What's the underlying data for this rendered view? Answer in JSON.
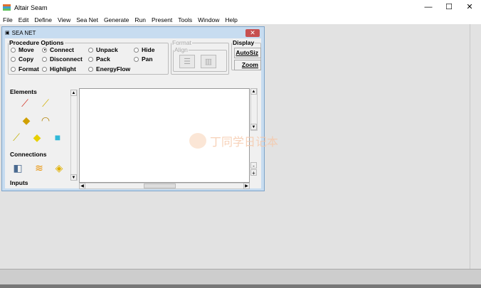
{
  "app": {
    "title": "Altair Seam",
    "minimize": "—",
    "maximize": "☐",
    "close": "✕"
  },
  "menu": [
    "File",
    "Edit",
    "Define",
    "View",
    "Sea Net",
    "Generate",
    "Run",
    "Present",
    "Tools",
    "Window",
    "Help"
  ],
  "child": {
    "title": "SEA NET",
    "close": "✕",
    "procedure_options": {
      "legend": "Procedure Options",
      "options": [
        {
          "label": "Move",
          "selected": false
        },
        {
          "label": "Connect",
          "selected": true
        },
        {
          "label": "Unpack",
          "selected": false
        },
        {
          "label": "Hide",
          "selected": false
        },
        {
          "label": "Copy",
          "selected": false
        },
        {
          "label": "Disconnect",
          "selected": false
        },
        {
          "label": "Pack",
          "selected": false
        },
        {
          "label": "Pan",
          "selected": false
        },
        {
          "label": "Format",
          "selected": false
        },
        {
          "label": "Highlight",
          "selected": false
        },
        {
          "label": "EnergyFlow",
          "selected": false
        }
      ]
    },
    "format": {
      "legend": "Format",
      "align_legend": "Align"
    },
    "display": {
      "legend": "Display",
      "autosize": "AutoSiz",
      "zoom": "Zoom"
    },
    "palette": {
      "elements": "Elements",
      "connections": "Connections",
      "inputs": "Inputs"
    },
    "zoom_minus": "-",
    "zoom_plus": "+"
  },
  "watermark": "丁同学日记本"
}
